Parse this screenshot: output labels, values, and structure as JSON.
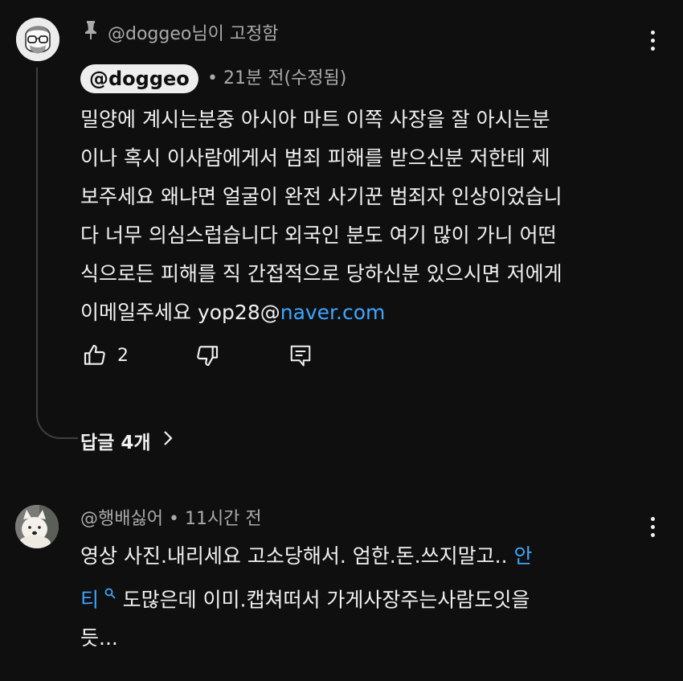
{
  "pinned_comment": {
    "pinned_label": "@doggeo님이 고정함",
    "author": "@doggeo",
    "time": "21분 전(수정됨)",
    "body_lines": [
      "밀양에 계시는분중 아시아 마트 이쪽 사장을 잘 아시는분",
      "이나 혹시 이사람에게서 범죄 피해를 받으신분 저한테 제",
      "보주세요 왜냐면 얼굴이 완전 사기꾼 범죄자 인상이었습니",
      "다 너무 의심스럽습니다 외국인 분도 여기 많이 가니 어떤",
      "식으로든 피해를 직 간접적으로 당하신분 있으시면 저에게"
    ],
    "last_line_prefix": "이메일주세요 yop28@",
    "last_line_link": "naver.com",
    "like_count": "2",
    "replies_label": "답글 4개"
  },
  "second_comment": {
    "author": "@행배싫어",
    "time": "11시간 전",
    "line1_text": "영상 사진.내리세요 고소당해서. 엄한.돈.쓰지말고.. ",
    "line1_link": "안",
    "line2_link": "티",
    "line2_text": "도많은데 이미.캡쳐떠서 가게사장주는사람도잇을",
    "line3_text": "듯..."
  },
  "colors": {
    "background": "#0f0f0f",
    "text": "#f1f1f1",
    "muted": "#aaaaaa",
    "link": "#3ea6ff",
    "chip": "#eeeeee"
  },
  "icons": [
    "pin-icon",
    "thumbs-up-icon",
    "thumbs-down-icon",
    "reply-icon",
    "chevron-right-icon",
    "more-vert-icon",
    "search-icon"
  ]
}
